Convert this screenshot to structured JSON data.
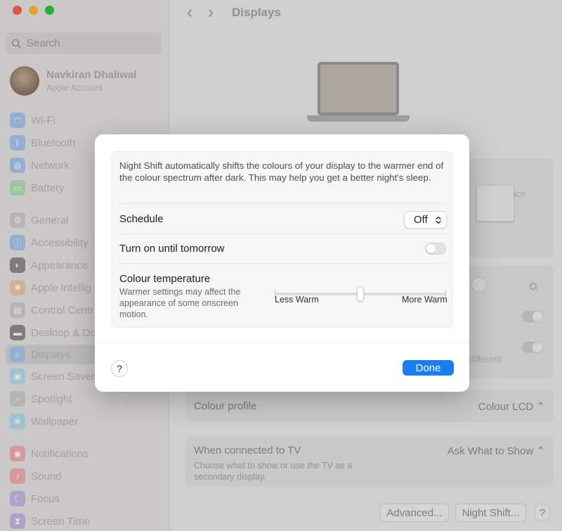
{
  "window": {
    "title": "Displays",
    "search_placeholder": "Search",
    "user": {
      "name": "Navkiran Dhaliwal",
      "subtitle": "Apple Account"
    }
  },
  "sidebar": {
    "items": [
      {
        "label": "Wi-Fi",
        "icon": "wifi-icon",
        "color": "#3b8cf5"
      },
      {
        "label": "Bluetooth",
        "icon": "bluetooth-icon",
        "color": "#3b8cf5"
      },
      {
        "label": "Network",
        "icon": "globe-icon",
        "color": "#3b8cf5"
      },
      {
        "label": "Battery",
        "icon": "battery-icon",
        "color": "#4ccd5c"
      },
      {
        "label": "General",
        "icon": "gear-icon",
        "color": "#9a9a9a"
      },
      {
        "label": "Accessibility",
        "icon": "accessibility-icon",
        "color": "#3b8cf5"
      },
      {
        "label": "Appearance",
        "icon": "appearance-icon",
        "color": "#2d2d2d"
      },
      {
        "label": "Apple Intellig",
        "icon": "sparkle-icon",
        "color": "#f29b4a"
      },
      {
        "label": "Control Centr",
        "icon": "control-centre-icon",
        "color": "#9a9a9a"
      },
      {
        "label": "Desktop & Do",
        "icon": "desktop-icon",
        "color": "#2d2d2d"
      },
      {
        "label": "Displays",
        "icon": "display-icon",
        "color": "#3b8cf5"
      },
      {
        "label": "Screen Saver",
        "icon": "screen-saver-icon",
        "color": "#4fb8e8"
      },
      {
        "label": "Spotlight",
        "icon": "spotlight-icon",
        "color": "#9a9a9a"
      },
      {
        "label": "Wallpaper",
        "icon": "wallpaper-icon",
        "color": "#4fb8e8"
      },
      {
        "label": "Notifications",
        "icon": "bell-icon",
        "color": "#f05a5a"
      },
      {
        "label": "Sound",
        "icon": "speaker-icon",
        "color": "#f05a5a"
      },
      {
        "label": "Focus",
        "icon": "moon-icon",
        "color": "#6a5acd"
      },
      {
        "label": "Screen Time",
        "icon": "hourglass-icon",
        "color": "#6a5acd"
      }
    ]
  },
  "background": {
    "more_space": "More Space",
    "different": "different",
    "colour_profile_label": "Colour profile",
    "colour_profile_value": "Colour LCD",
    "tv_label": "When connected to TV",
    "tv_value": "Ask What to Show",
    "tv_sub": "Choose what to show or use the TV as a secondary display.",
    "advanced_button": "Advanced...",
    "night_shift_button": "Night Shift...",
    "help_label": "?"
  },
  "dialog": {
    "description": "Night Shift automatically shifts the colours of your display to the warmer end of the colour spectrum after dark. This may help you get a better night's sleep.",
    "schedule_label": "Schedule",
    "schedule_value": "Off",
    "turn_on_label": "Turn on until tomorrow",
    "turn_on_enabled": false,
    "temperature_label": "Colour temperature",
    "temperature_sub": "Warmer settings may affect the appearance of some onscreen motion.",
    "temperature_min_label": "Less Warm",
    "temperature_max_label": "More Warm",
    "temperature_value": 0.5,
    "help_label": "?",
    "done_label": "Done",
    "accent_color": "#1a7df0"
  }
}
